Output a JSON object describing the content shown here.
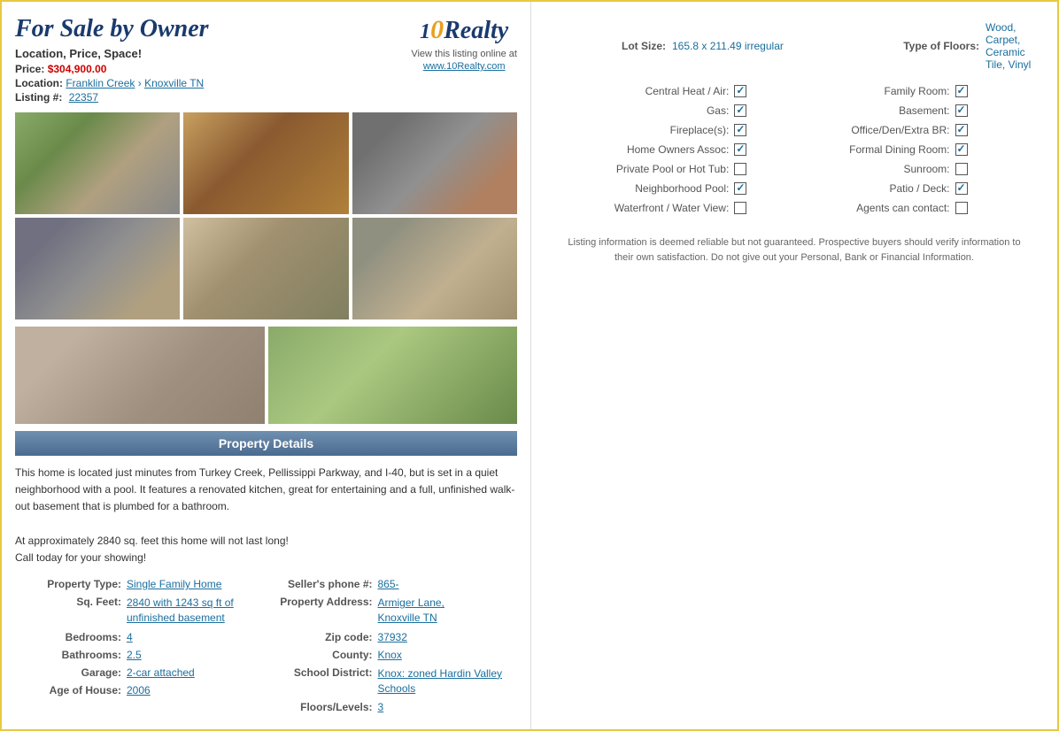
{
  "header": {
    "title": "For Sale by Owner",
    "tagline": "Location, Price, Space!",
    "price_label": "Price:",
    "price": "$304,900.00",
    "location_label": "Location:",
    "location_part1": "Franklin Creek",
    "location_arrow": "›",
    "location_part2": "Knoxville TN",
    "listing_label": "Listing #:",
    "listing_number": "22357"
  },
  "logo": {
    "text_part1": "10",
    "text_part2": "Realty",
    "view_text": "View this listing online at",
    "url": "www.10Realty.com"
  },
  "property_details_header": "Property Details",
  "description": [
    "This home is located just minutes from Turkey Creek, Pellissippi Parkway, and I-40, but is set in a quiet neighborhood with a pool. It features a renovated kitchen, great for entertaining and a full, unfinished walk-out basement that is plumbed for a bathroom.",
    "",
    "At approximately 2840 sq. feet this home will not last long!",
    "Call today for your showing!"
  ],
  "left_details": {
    "columns": [
      {
        "rows": [
          {
            "label": "Property Type:",
            "value": "Single Family Home"
          },
          {
            "label": "Sq. Feet:",
            "value": "2840 with 1243 sq ft of unfinished basement"
          },
          {
            "label": "Bedrooms:",
            "value": "4"
          },
          {
            "label": "Bathrooms:",
            "value": "2.5"
          },
          {
            "label": "Garage:",
            "value": "2-car attached"
          },
          {
            "label": "Age of House:",
            "value": "2006"
          }
        ]
      },
      {
        "rows": [
          {
            "label": "Seller's phone #:",
            "value": "865-"
          },
          {
            "label": "Property Address:",
            "value": "Armiger Lane,\nKnoxville TN"
          },
          {
            "label": "Zip code:",
            "value": "37932"
          },
          {
            "label": "County:",
            "value": "Knox"
          },
          {
            "label": "School District:",
            "value": "Knox: zoned Hardin Valley Schools"
          },
          {
            "label": "Floors/Levels:",
            "value": "3"
          }
        ]
      }
    ]
  },
  "right": {
    "lot_size_label": "Lot Size:",
    "lot_size_value": "165.8 x 211.49 irregular",
    "type_floors_label": "Type of Floors:",
    "type_floors_value": "Wood, Carpet, Ceramic Tile, Vinyl",
    "features": [
      {
        "label": "Central Heat / Air:",
        "checked": true,
        "right_label": "Family Room:",
        "right_checked": true
      },
      {
        "label": "Gas:",
        "checked": true,
        "right_label": "Basement:",
        "right_checked": true
      },
      {
        "label": "Fireplace(s):",
        "checked": true,
        "right_label": "Office/Den/Extra BR:",
        "right_checked": true
      },
      {
        "label": "Home Owners Assoc:",
        "checked": true,
        "right_label": "Formal Dining Room:",
        "right_checked": true
      },
      {
        "label": "Private Pool or Hot Tub:",
        "checked": false,
        "right_label": "Sunroom:",
        "right_checked": false
      },
      {
        "label": "Neighborhood Pool:",
        "checked": true,
        "right_label": "Patio / Deck:",
        "right_checked": true
      },
      {
        "label": "Waterfront / Water View:",
        "checked": false,
        "right_label": "Agents can contact:",
        "right_checked": false
      }
    ],
    "disclaimer": "Listing information is deemed reliable but not guaranteed. Prospective buyers should verify information to their own satisfaction. Do not give out your Personal, Bank or Financial Information."
  }
}
